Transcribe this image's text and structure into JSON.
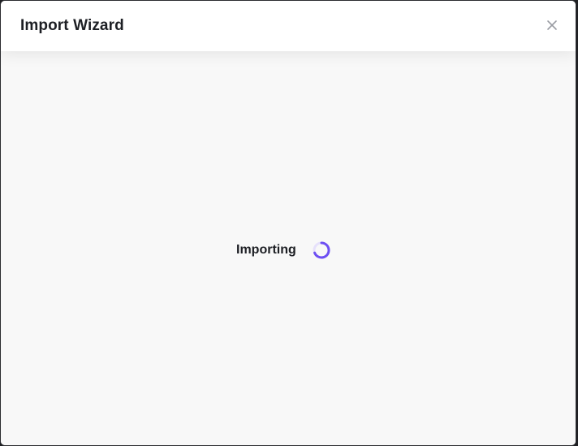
{
  "dialog": {
    "title": "Import Wizard",
    "close_icon": "close-icon"
  },
  "status": {
    "text": "Importing",
    "spinner_icon": "loading-spinner-icon"
  },
  "colors": {
    "accent": "#6d4ff2",
    "title_text": "#1d1f24",
    "body_background": "#f8f8f8",
    "header_background": "#ffffff",
    "close_icon": "#9a9ca3"
  }
}
